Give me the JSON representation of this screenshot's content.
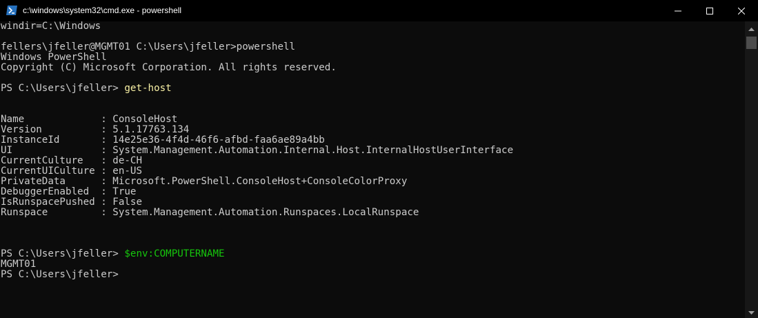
{
  "window": {
    "title": "c:\\windows\\system32\\cmd.exe - powershell",
    "icon": "powershell-icon"
  },
  "controls": {
    "minimize_icon": "minimize-icon",
    "maximize_icon": "maximize-icon",
    "close_icon": "close-icon"
  },
  "console": {
    "line01": "windir=C:\\Windows",
    "line03": "fellers\\jfeller@MGMT01 C:\\Users\\jfeller>powershell",
    "line04": "Windows PowerShell",
    "line05": "Copyright (C) Microsoft Corporation. All rights reserved.",
    "line07_prompt": "PS C:\\Users\\jfeller> ",
    "line07_cmd": "get-host",
    "line10": "Name             : ConsoleHost",
    "line11": "Version          : 5.1.17763.134",
    "line12": "InstanceId       : 14e25e36-4f4d-46f6-afbd-faa6ae89a4bb",
    "line13": "UI               : System.Management.Automation.Internal.Host.InternalHostUserInterface",
    "line14": "CurrentCulture   : de-CH",
    "line15": "CurrentUICulture : en-US",
    "line16": "PrivateData      : Microsoft.PowerShell.ConsoleHost+ConsoleColorProxy",
    "line17": "DebuggerEnabled  : True",
    "line18": "IsRunspacePushed : False",
    "line19": "Runspace         : System.Management.Automation.Runspaces.LocalRunspace",
    "line23_prompt": "PS C:\\Users\\jfeller> ",
    "line23_cmd": "$env:COMPUTERNAME",
    "line24": "MGMT01",
    "line25_prompt": "PS C:\\Users\\jfeller>"
  },
  "colors": {
    "background": "#0c0c0c",
    "text": "#cccccc",
    "command_yellow": "#f9f1a5",
    "variable_green": "#16c60c"
  }
}
